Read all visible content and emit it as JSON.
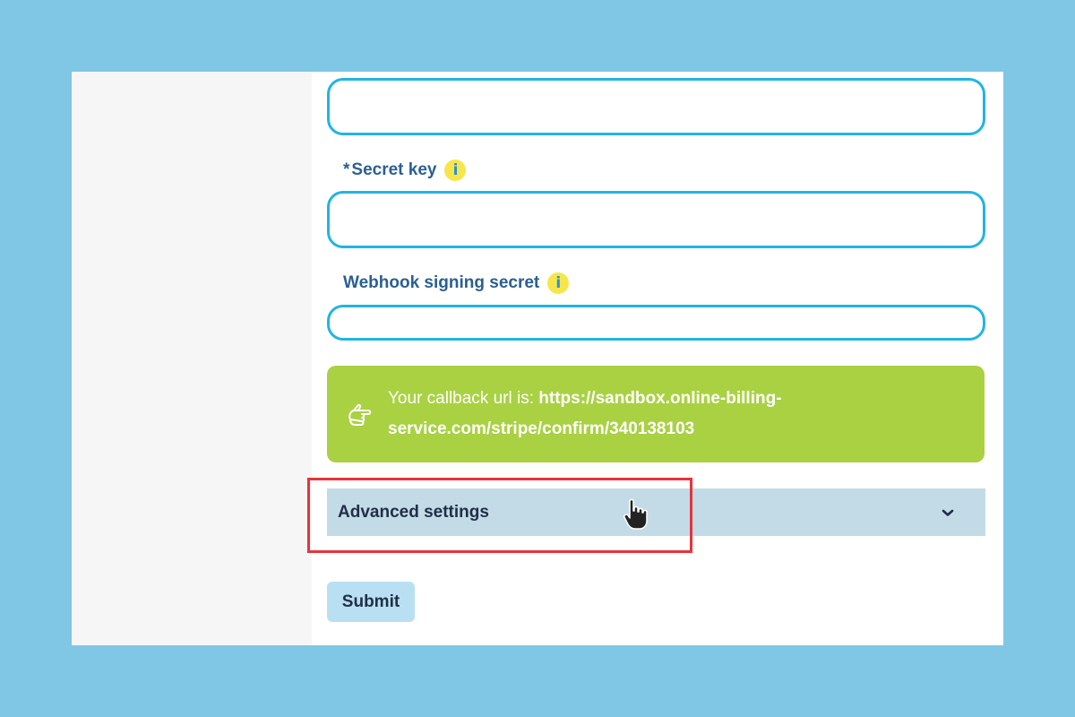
{
  "form": {
    "publishable_key_value": "",
    "secret_key": {
      "required_marker": "*",
      "label": "Secret key",
      "value": ""
    },
    "webhook_secret": {
      "label": "Webhook signing secret",
      "value": ""
    },
    "info_icon_glyph": "i"
  },
  "callback": {
    "prefix": "Your callback url is: ",
    "url": "https://sandbox.online-billing-service.com/stripe/confirm/340138103",
    "icon": "pointing-hand-icon",
    "bg_color": "#a9d142"
  },
  "advanced": {
    "label": "Advanced settings",
    "icon": "chevron-down-icon",
    "expanded": false
  },
  "submit": {
    "label": "Submit"
  },
  "colors": {
    "accent_border": "#20b5e3",
    "label_text": "#2a5f93",
    "highlight": "#e8333a",
    "info_icon": "#f7e64a",
    "backdrop": "#7fc7e5"
  }
}
